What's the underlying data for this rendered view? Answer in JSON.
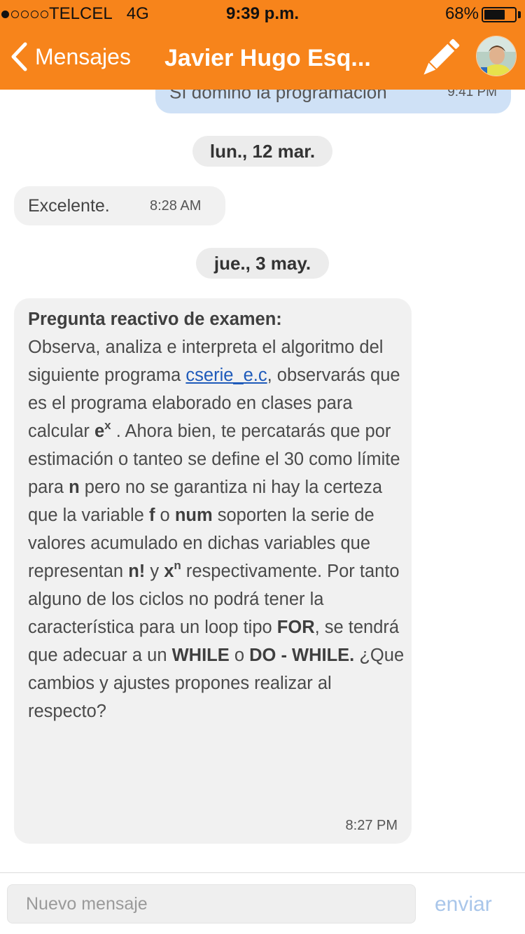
{
  "status_bar": {
    "carrier": "TELCEL",
    "network": "4G",
    "time": "9:39 p.m.",
    "battery_pct": "68%",
    "battery_level": 0.68,
    "signal_bars_filled": 1,
    "signal_bars_total": 5
  },
  "nav": {
    "back_label": "Mensajes",
    "title": "Javier Hugo Esq...",
    "compose_icon": "pencil-icon",
    "avatar_icon": "contact-avatar"
  },
  "messages": {
    "previous_out": {
      "text": "Sí domino la programación",
      "time": "9:41 PM"
    },
    "date_1": "lun., 12 mar.",
    "excelente": {
      "text": "Excelente.",
      "time": "8:28 AM"
    },
    "date_2": "jue., 3 may.",
    "question": {
      "heading": "Pregunta reactivo de examen:",
      "p1": "Observa, analiza e interpreta el algoritmo del siguiente programa ",
      "link": "cserie_e.c",
      "p2": ", observarás que es el programa elaborado en clases para calcular ",
      "e_base": "e",
      "e_exp": "x",
      "p3": " . Ahora bien, te percatarás que por estimación o tanteo se define el 30 como límite para ",
      "n": "n",
      "p4": " pero no se garantiza ni hay la certeza que la variable ",
      "f": "f",
      "p5": " o ",
      "num": "num",
      "p6": " soporten la serie de valores acumulado en dichas variables que representan ",
      "nfact": "n!",
      "p7": " y ",
      "x_base": "x",
      "x_exp": "n",
      "p8": " respectivamente. Por tanto alguno de los ciclos no podrá tener la característica para un loop tipo ",
      "for": "FOR",
      "p9": ", se tendrá que adecuar a un ",
      "while": "WHILE",
      "p10": " o ",
      "dowhile": "DO - WHILE.",
      "p11": " ¿Que cambios y ajustes propones realizar al respecto?",
      "time": "8:27 PM"
    }
  },
  "input_bar": {
    "placeholder": "Nuevo mensaje",
    "send_label": "enviar"
  },
  "colors": {
    "header": "#f7841b",
    "outgoing_bubble": "#cfe1f6",
    "incoming_bubble": "#f1f1f1",
    "link": "#1e5aba",
    "send_disabled": "#a9c6ea"
  }
}
